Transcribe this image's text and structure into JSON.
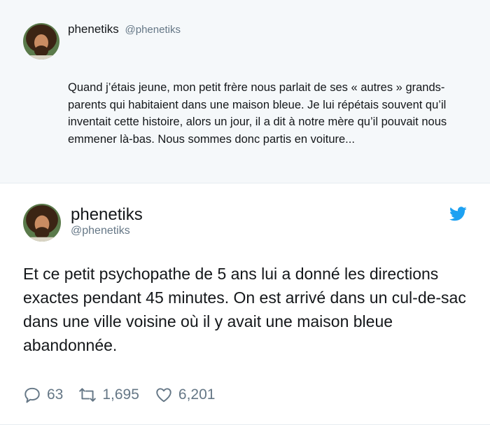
{
  "quoted_tweet": {
    "name": "phenetiks",
    "handle": "@phenetiks",
    "text": "Quand j’étais jeune, mon petit frère nous parlait de ses « autres » grands-parents qui habitaient dans une maison bleue. Je lui répétais souvent qu’il inventait cette histoire, alors un jour, il a dit à notre mère qu’il pouvait nous emmener là-bas. Nous sommes donc partis en voiture..."
  },
  "tweet": {
    "name": "phenetiks",
    "handle": "@phenetiks",
    "text": "Et ce petit psychopathe de 5 ans lui a donné les directions exactes pendant 45 minutes. On est arrivé dans un cul-de-sac dans une ville voisine où il y avait une maison bleue abandonnée.",
    "replies": "63",
    "retweets": "1,695",
    "likes": "6,201"
  },
  "colors": {
    "twitter_blue": "#1da1f2",
    "secondary_text": "#657786",
    "card_bg": "#f5f8fa"
  },
  "icons": {
    "logo": "twitter-bird-icon",
    "reply": "reply-icon",
    "retweet": "retweet-icon",
    "like": "heart-icon"
  }
}
